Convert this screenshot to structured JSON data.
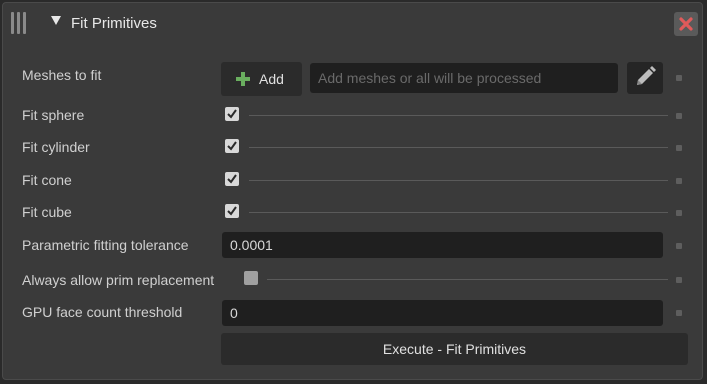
{
  "window": {
    "title": "Fit Primitives",
    "grip_icon": "grip-icon",
    "collapse_icon": "triangle-down-icon",
    "close_icon": "close-x-icon",
    "close_color": "#e05a5a"
  },
  "fields": {
    "meshes": {
      "label": "Meshes to fit",
      "add_label": "Add",
      "add_icon": "plus-icon",
      "placeholder": "Add meshes or all will be processed",
      "edit_icon": "pencil-icon"
    },
    "fit_sphere": {
      "label": "Fit sphere",
      "checked": true
    },
    "fit_cylinder": {
      "label": "Fit cylinder",
      "checked": true
    },
    "fit_cone": {
      "label": "Fit cone",
      "checked": true
    },
    "fit_cube": {
      "label": "Fit cube",
      "checked": true
    },
    "tolerance": {
      "label": "Parametric fitting tolerance",
      "value": "0.0001"
    },
    "allow_replace": {
      "label": "Always allow prim replacement",
      "checked": false
    },
    "gpu_threshold": {
      "label": "GPU face count threshold",
      "value": "0"
    }
  },
  "execute": {
    "label": "Execute - Fit Primitives"
  },
  "colors": {
    "accent_green": "#6aae5f",
    "panel_bg": "#3a3a3a",
    "field_bg": "#1f1f1f"
  }
}
